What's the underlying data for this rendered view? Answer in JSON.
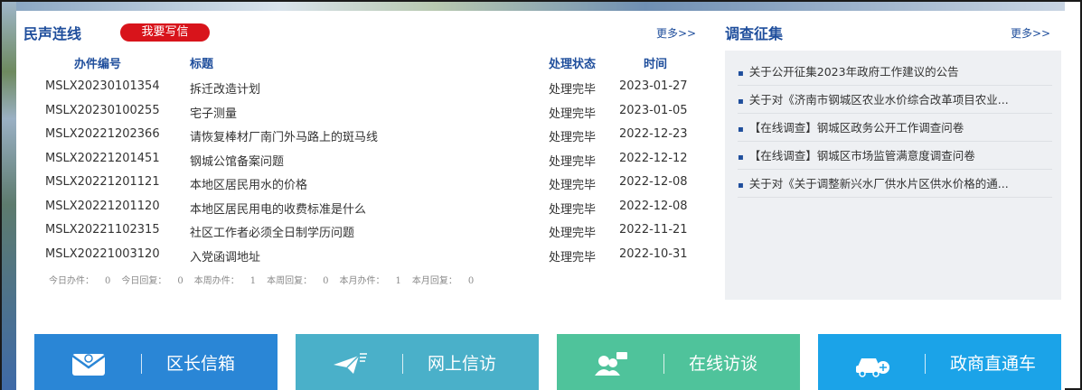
{
  "left": {
    "title": "民声连线",
    "write_button": "我要写信",
    "more": "更多>>",
    "columns": [
      "办件编号",
      "标题",
      "处理状态",
      "时间"
    ],
    "rows": [
      {
        "id": "MSLX20230101354",
        "title": "拆迁改造计划",
        "status": "处理完毕",
        "date": "2023-01-27"
      },
      {
        "id": "MSLX20230100255",
        "title": "宅子测量",
        "status": "处理完毕",
        "date": "2023-01-05"
      },
      {
        "id": "MSLX20221202366",
        "title": "请恢复棒材厂南门外马路上的斑马线",
        "status": "处理完毕",
        "date": "2022-12-23"
      },
      {
        "id": "MSLX20221201451",
        "title": "钢城公馆备案问题",
        "status": "处理完毕",
        "date": "2022-12-12"
      },
      {
        "id": "MSLX20221201121",
        "title": "本地区居民用水的价格",
        "status": "处理完毕",
        "date": "2022-12-08"
      },
      {
        "id": "MSLX20221201120",
        "title": "本地区居民用电的收费标准是什么",
        "status": "处理完毕",
        "date": "2022-12-08"
      },
      {
        "id": "MSLX20221102315",
        "title": "社区工作者必须全日制学历问题",
        "status": "处理完毕",
        "date": "2022-11-21"
      },
      {
        "id": "MSLX20221003120",
        "title": "入党函调地址",
        "status": "处理完毕",
        "date": "2022-10-31"
      }
    ],
    "stats": [
      {
        "label": "今日办件：",
        "value": "0"
      },
      {
        "label": "今日回复：",
        "value": "0"
      },
      {
        "label": "本周办件：",
        "value": "1"
      },
      {
        "label": "本周回复：",
        "value": "0"
      },
      {
        "label": "本月办件：",
        "value": "1"
      },
      {
        "label": "本月回复：",
        "value": "0"
      }
    ]
  },
  "right": {
    "title": "调查征集",
    "more": "更多>>",
    "items": [
      "关于公开征集2023年政府工作建议的公告",
      "关于对《济南市钢城区农业水价综合改革项目农业...",
      "【在线调查】钢城区政务公开工作调查问卷",
      "【在线调查】钢城区市场监管满意度调查问卷",
      "关于对《关于调整新兴水厂供水片区供水价格的通..."
    ]
  },
  "bottom_buttons": [
    {
      "label": "区长信箱",
      "icon": "mail-envelope-icon",
      "color": "#2a86d6"
    },
    {
      "label": "网上信访",
      "icon": "paper-plane-icon",
      "color": "#4ab0c9"
    },
    {
      "label": "在线访谈",
      "icon": "people-chat-icon",
      "color": "#4fc39b"
    },
    {
      "label": "政商直通车",
      "icon": "car-icon",
      "color": "#1ba3e8"
    }
  ]
}
